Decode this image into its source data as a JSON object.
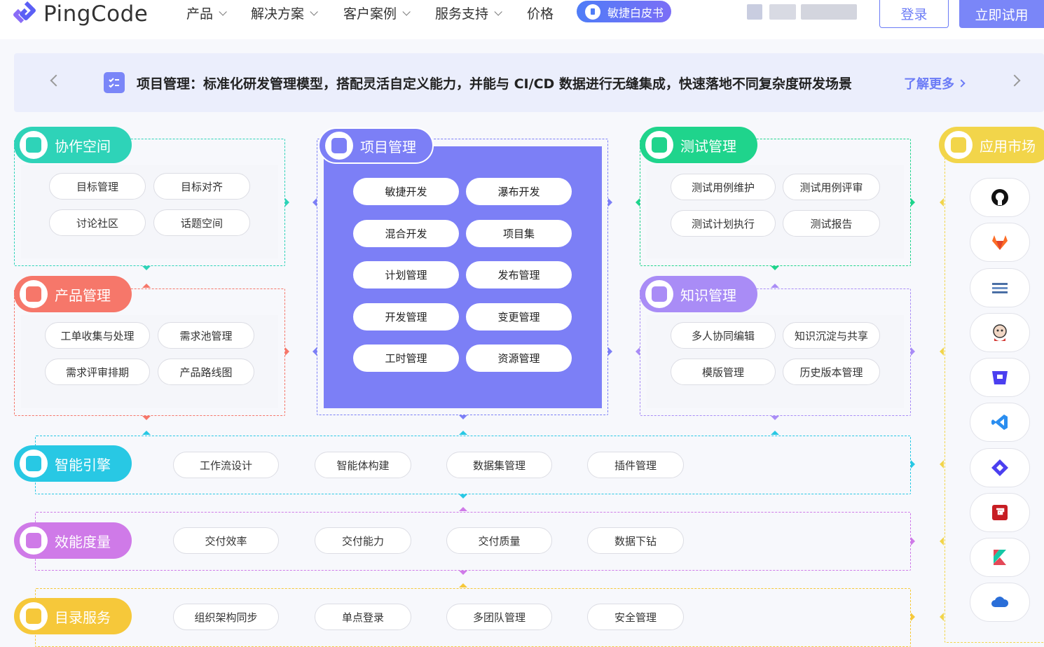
{
  "nav": {
    "logo_text": "PingCode",
    "items": [
      "产品",
      "解决方案",
      "客户案例",
      "服务支持",
      "价格"
    ],
    "badge": "敏捷白皮书",
    "login": "登录",
    "try": "立即试用"
  },
  "banner": {
    "text": "项目管理：标准化研发管理模型，搭配灵活自定义能力，并能与 CI/CD 数据进行无缝集成，快速落地不同复杂度研发场景",
    "link": "了解更多"
  },
  "collab": {
    "title": "协作空间",
    "items": [
      "目标管理",
      "目标对齐",
      "讨论社区",
      "话题空间"
    ]
  },
  "product": {
    "title": "产品管理",
    "items": [
      "工单收集与处理",
      "需求池管理",
      "需求评审排期",
      "产品路线图"
    ]
  },
  "project": {
    "title": "项目管理",
    "items": [
      "敏捷开发",
      "瀑布开发",
      "混合开发",
      "项目集",
      "计划管理",
      "发布管理",
      "开发管理",
      "变更管理",
      "工时管理",
      "资源管理"
    ]
  },
  "test": {
    "title": "测试管理",
    "items": [
      "测试用例维护",
      "测试用例评审",
      "测试计划执行",
      "测试报告"
    ]
  },
  "knowledge": {
    "title": "知识管理",
    "items": [
      "多人协同编辑",
      "知识沉淀与共享",
      "模版管理",
      "历史版本管理"
    ]
  },
  "ai": {
    "title": "智能引擎",
    "items": [
      "工作流设计",
      "智能体构建",
      "数据集管理",
      "插件管理"
    ]
  },
  "metrics": {
    "title": "效能度量",
    "items": [
      "交付效率",
      "交付能力",
      "交付质量",
      "数据下钻"
    ]
  },
  "directory": {
    "title": "目录服务",
    "items": [
      "组织架构同步",
      "单点登录",
      "多团队管理",
      "安全管理"
    ]
  },
  "market": {
    "title": "应用市场",
    "apps": [
      "github-icon",
      "gitlab-icon",
      "stack-icon",
      "jenkins-icon",
      "bitbucket-icon",
      "vscode-icon",
      "jira-icon",
      "gitee-icon",
      "kotlin-icon",
      "cloud-icon"
    ]
  },
  "colors": {
    "accent": "#7a86f8",
    "collab": "#2ed3b8",
    "product": "#f6776a",
    "project": "#7c7ff6",
    "test": "#1fd48c",
    "knowledge": "#a98cf6",
    "ai": "#28c8e4",
    "metrics": "#cf7ae8",
    "directory": "#f6c83a",
    "market": "#f2d54a"
  }
}
